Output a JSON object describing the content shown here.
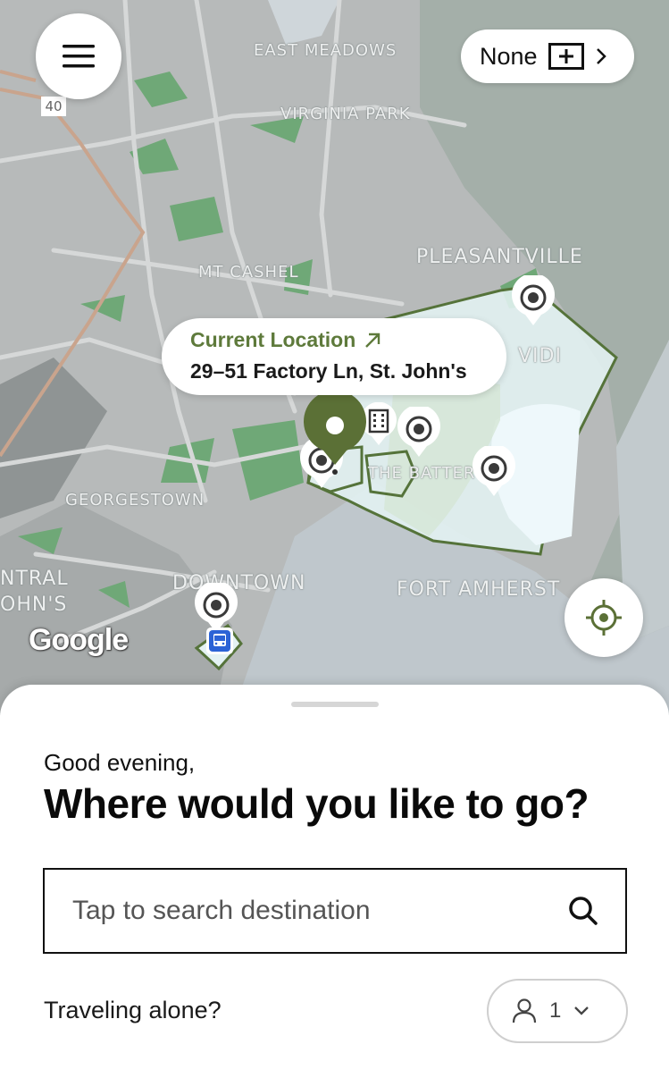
{
  "map": {
    "labels": {
      "east_meadows": "EAST MEADOWS",
      "virginia_park": "VIRGINIA PARK",
      "pleasantville": "PLEASANTVILLE",
      "mt_cashel": "MT CASHEL",
      "vidi": "VIDI",
      "the_battery": "THE BATTER",
      "georgestown": "GEORGESTOWN",
      "downtown": "DOWNTOWN",
      "fort_amherst": "FORT AMHERST",
      "central_line1": "NTRAL",
      "central_line2": "OHN'S"
    },
    "road_shield": "40",
    "google_logo": "Google",
    "accent_color": "#5e7a3b"
  },
  "header": {
    "menu_icon": "hamburger-menu-icon",
    "pass_pill": {
      "label": "None",
      "icon": "plus-square-icon",
      "chevron": "chevron-right-icon"
    }
  },
  "current_location": {
    "label": "Current Location",
    "arrow_icon": "arrow-up-right-icon",
    "address": "29–51 Factory Ln, St. John's"
  },
  "sheet": {
    "greeting": "Good evening,",
    "headline": "Where would you like to go?",
    "search": {
      "placeholder": "Tap to search destination",
      "icon": "search-icon"
    },
    "traveling_alone_label": "Traveling alone?",
    "passengers": {
      "count": "1",
      "icon": "person-icon",
      "chevron": "chevron-down-icon"
    }
  }
}
